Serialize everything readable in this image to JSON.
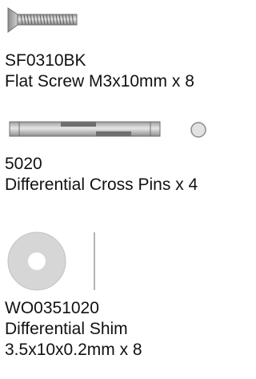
{
  "parts": [
    {
      "code": "SF0310BK",
      "description_lines": [
        "Flat Screw M3x10mm x 8"
      ],
      "icon": "flat-screw-icon"
    },
    {
      "code": "5020",
      "description_lines": [
        "Differential Cross Pins x 4"
      ],
      "icon": "cross-pin-icon"
    },
    {
      "code": "WO0351020",
      "description_lines": [
        "Differential Shim",
        "3.5x10x0.2mm x 8"
      ],
      "icon": "shim-washer-icon"
    }
  ],
  "colors": {
    "metal_light": "#d4d4d4",
    "metal_mid": "#a8a8a8",
    "metal_dark": "#6e6e6e",
    "text": "#111111"
  }
}
